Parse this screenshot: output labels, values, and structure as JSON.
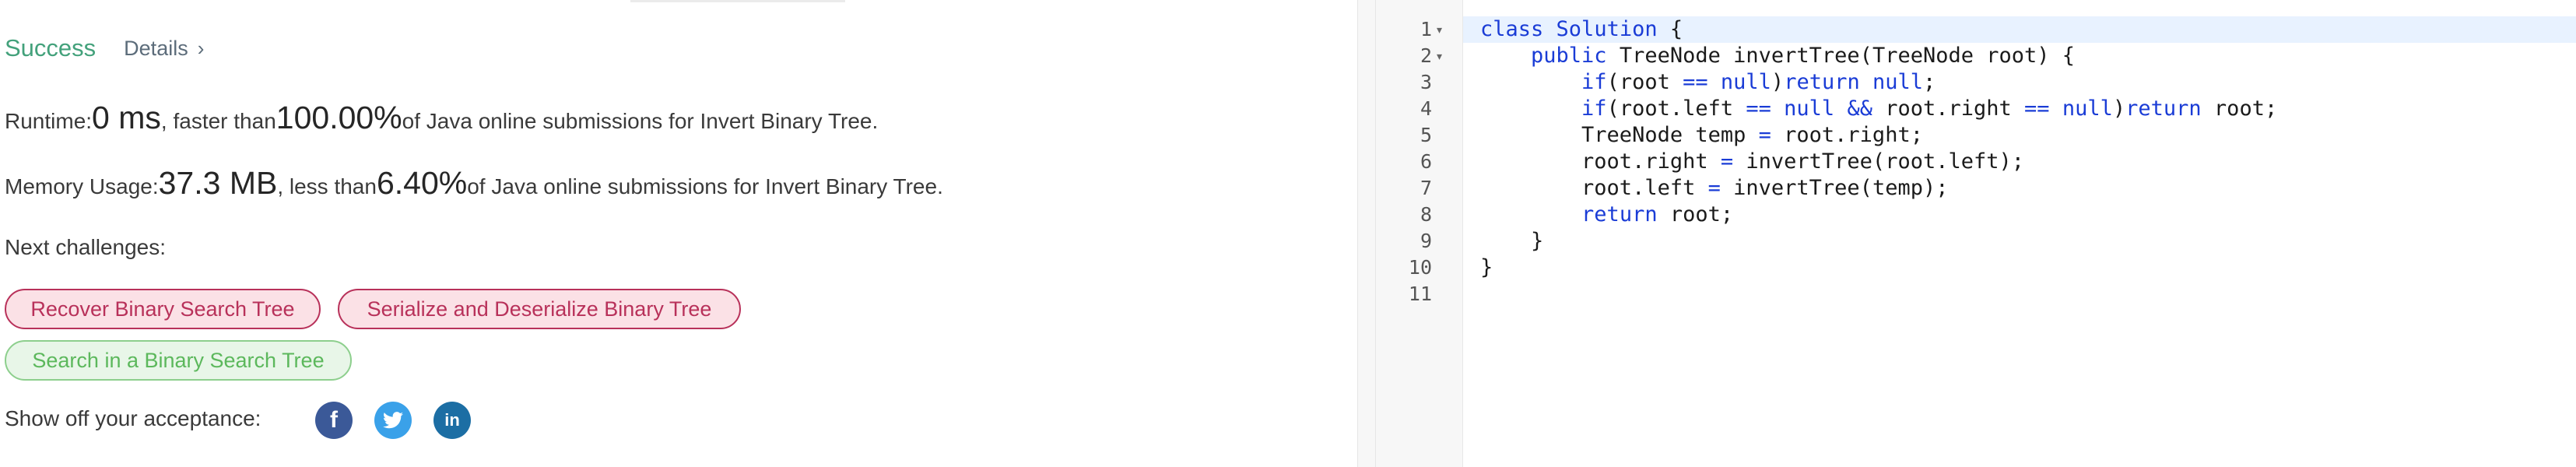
{
  "result": {
    "status": "Success",
    "details_label": "Details",
    "runtime": {
      "label": "Runtime: ",
      "value": "0 ms",
      "mid": ", faster than ",
      "percent": "100.00%",
      "suffix": " of Java online submissions for Invert Binary Tree."
    },
    "memory": {
      "label": "Memory Usage: ",
      "value": "37.3 MB",
      "mid": ", less than ",
      "percent": "6.40%",
      "suffix": " of Java online submissions for Invert Binary Tree."
    },
    "next_label": "Next challenges:",
    "challenges": [
      {
        "label": "Recover Binary Search Tree",
        "difficulty": "hard"
      },
      {
        "label": "Serialize and Deserialize Binary Tree",
        "difficulty": "hard"
      },
      {
        "label": "Search in a Binary Search Tree",
        "difficulty": "easy"
      }
    ],
    "share_label": "Show off your acceptance:",
    "social": [
      "facebook-icon",
      "twitter-icon",
      "linkedin-icon"
    ]
  },
  "editor": {
    "language": "Java",
    "lines": [
      {
        "n": "1",
        "fold": "▾",
        "text": "class Solution {"
      },
      {
        "n": "2",
        "fold": "▾",
        "text": "    public TreeNode invertTree(TreeNode root) {"
      },
      {
        "n": "3",
        "fold": "",
        "text": "        if(root == null)return null;"
      },
      {
        "n": "4",
        "fold": "",
        "text": "        if(root.left == null && root.right == null)return root;"
      },
      {
        "n": "5",
        "fold": "",
        "text": "        TreeNode temp = root.right;"
      },
      {
        "n": "6",
        "fold": "",
        "text": "        root.right = invertTree(root.left);"
      },
      {
        "n": "7",
        "fold": "",
        "text": "        root.left = invertTree(temp);"
      },
      {
        "n": "8",
        "fold": "",
        "text": "        return root;"
      },
      {
        "n": "9",
        "fold": "",
        "text": "    }"
      },
      {
        "n": "10",
        "fold": "",
        "text": "}"
      },
      {
        "n": "11",
        "fold": "",
        "text": ""
      }
    ]
  },
  "colors": {
    "success": "#43a17b",
    "hard_chip_bg": "#fbe1e6",
    "hard_chip_text": "#b8315a",
    "easy_chip_bg": "#e8f6e8",
    "easy_chip_text": "#5cb85c",
    "keyword": "#1a3cd6",
    "active_line": "#e8f2ff"
  }
}
